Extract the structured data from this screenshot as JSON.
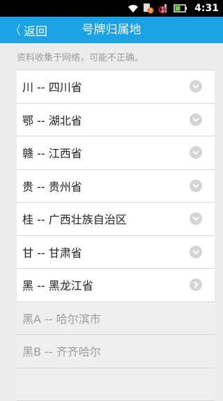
{
  "status_bar": {
    "time": "4:31",
    "icons": [
      "wifi-icon",
      "sim-alert-icon",
      "no-signal-icon",
      "battery-icon"
    ]
  },
  "header": {
    "back_label": "返回",
    "title": "号牌归属地"
  },
  "notice": "资料收集于网络，可能不正确。",
  "colors": {
    "title_bar": "#1aa1e6",
    "status_bar": "#000000",
    "list_bg": "#ffffff",
    "sub_bg": "#efefef",
    "page_bg": "#ececec"
  },
  "rows": [
    {
      "label": "川 -- 四川省",
      "icon": "chevron-down-icon"
    },
    {
      "label": "鄂 -- 湖北省",
      "icon": "chevron-down-icon"
    },
    {
      "label": "赣 -- 江西省",
      "icon": "chevron-down-icon"
    },
    {
      "label": "贵 -- 贵州省",
      "icon": "chevron-down-icon"
    },
    {
      "label": "桂 -- 广西壮族自治区",
      "icon": "chevron-down-icon"
    },
    {
      "label": "甘 -- 甘肃省",
      "icon": "chevron-down-icon"
    },
    {
      "label": "黑 -- 黑龙江省",
      "icon": "chevron-right-icon"
    }
  ],
  "sub_rows": [
    {
      "label": "黑A -- 哈尔滨市"
    },
    {
      "label": "黑B -- 齐齐哈尔"
    },
    {
      "label": ""
    }
  ]
}
